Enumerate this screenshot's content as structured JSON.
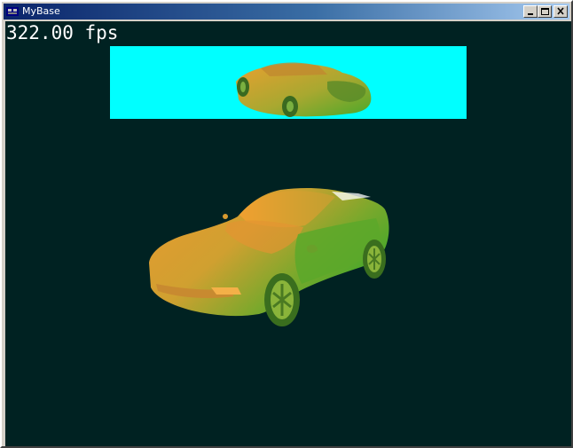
{
  "window": {
    "title": "MyBase",
    "controls": {
      "minimize_icon": "minimize-icon",
      "maximize_icon": "maximize-icon",
      "close_icon": "close-icon"
    }
  },
  "scene": {
    "fps_text": "322.00 fps",
    "background_color": "#002222",
    "viewport_background": "#00ffff",
    "car_colors": [
      "#e8a030",
      "#4aa82a"
    ]
  }
}
